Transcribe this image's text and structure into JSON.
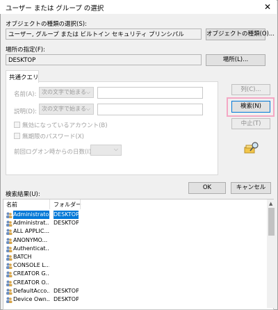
{
  "window": {
    "title": "ユーザー または グループ の選択",
    "close": "✕"
  },
  "object_type": {
    "label": "オブジェクトの種類の選択(S):",
    "value": "ユーザー, グループ または ビルトイン セキュリティ プリンシパル",
    "button": "オブジェクトの種類(O)..."
  },
  "location": {
    "label": "場所の指定(F):",
    "value": "DESKTOP",
    "button": "場所(L)..."
  },
  "query": {
    "tab": "共通クエリ",
    "name_label": "名前(A):",
    "name_op": "次の文字で始まる",
    "desc_label": "説明(D):",
    "desc_op": "次の文字で始まる",
    "disabled_accounts": "無効になっているアカウント(B)",
    "no_expire_pw": "無期限のパスワード(X)",
    "days_since_logon": "前回ログオン時からの日数(I):"
  },
  "buttons": {
    "columns": "列(C)...",
    "search": "検索(N)",
    "stop": "中止(T)",
    "ok": "OK",
    "cancel": "キャンセル"
  },
  "results": {
    "label": "検索結果(U):",
    "col_name": "名前",
    "col_folder": "フォルダー",
    "rows": [
      {
        "name": "Administrator",
        "folder": "DESKTOP-",
        "selected": true
      },
      {
        "name": "Administrat...",
        "folder": "DESKTOP-",
        "selected": false
      },
      {
        "name": "ALL APPLIC...",
        "folder": "",
        "selected": false
      },
      {
        "name": "ANONYMO...",
        "folder": "",
        "selected": false
      },
      {
        "name": "Authenticat...",
        "folder": "",
        "selected": false
      },
      {
        "name": "BATCH",
        "folder": "",
        "selected": false
      },
      {
        "name": "CONSOLE L...",
        "folder": "",
        "selected": false
      },
      {
        "name": "CREATOR G...",
        "folder": "",
        "selected": false
      },
      {
        "name": "CREATOR O...",
        "folder": "",
        "selected": false
      },
      {
        "name": "DefaultAcco...",
        "folder": "DESKTOP-",
        "selected": false
      },
      {
        "name": "Device Own...",
        "folder": "DESKTOP-",
        "selected": false
      }
    ]
  },
  "colors": {
    "accent": "#0078d7",
    "highlight_box": "#f4a8c4"
  }
}
